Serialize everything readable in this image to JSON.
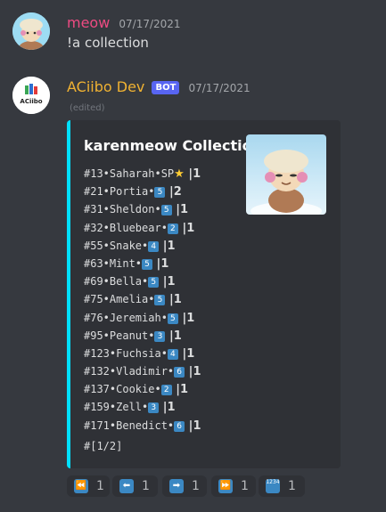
{
  "message1": {
    "username": "meow",
    "username_color": "#ed4b82",
    "timestamp": "07/17/2021",
    "content": "!a collection"
  },
  "message2": {
    "username": "ACiibo Dev",
    "username_color": "#f0b232",
    "bot_tag": "BOT",
    "timestamp": "07/17/2021",
    "edited": "(edited)",
    "avatar_logo_text": "ACiibo",
    "embed": {
      "accent_color": "#00e0ff",
      "title": "karenmeow Collection",
      "entries": [
        {
          "text": "#13•Saharah•SP",
          "badge": "",
          "star": "★",
          "count": "1"
        },
        {
          "text": "#21•Portia•",
          "badge": "5",
          "star": "",
          "count": "2"
        },
        {
          "text": "#31•Sheldon•",
          "badge": "5",
          "star": "",
          "count": "1"
        },
        {
          "text": "#32•Bluebear•",
          "badge": "2",
          "star": "",
          "count": "1"
        },
        {
          "text": "#55•Snake•",
          "badge": "4",
          "star": "",
          "count": "1"
        },
        {
          "text": "#63•Mint•",
          "badge": "5",
          "star": "",
          "count": "1"
        },
        {
          "text": "#69•Bella•",
          "badge": "5",
          "star": "",
          "count": "1"
        },
        {
          "text": "#75•Amelia•",
          "badge": "5",
          "star": "",
          "count": "1"
        },
        {
          "text": "#76•Jeremiah•",
          "badge": "5",
          "star": "",
          "count": "1"
        },
        {
          "text": "#95•Peanut•",
          "badge": "3",
          "star": "",
          "count": "1"
        },
        {
          "text": "#123•Fuchsia•",
          "badge": "4",
          "star": "",
          "count": "1"
        },
        {
          "text": "#132•Vladimir•",
          "badge": "6",
          "star": "",
          "count": "1"
        },
        {
          "text": "#137•Cookie•",
          "badge": "2",
          "star": "",
          "count": "1"
        },
        {
          "text": "#159•Zell•",
          "badge": "3",
          "star": "",
          "count": "1"
        },
        {
          "text": "#171•Benedict•",
          "badge": "6",
          "star": "",
          "count": "1"
        }
      ],
      "page": "#[1/2]"
    }
  },
  "reactions": [
    {
      "icon": "first-page-icon",
      "glyph": "⏪",
      "count": "1"
    },
    {
      "icon": "prev-page-icon",
      "glyph": "⬅",
      "count": "1"
    },
    {
      "icon": "next-page-icon",
      "glyph": "➡",
      "count": "1"
    },
    {
      "icon": "last-page-icon",
      "glyph": "⏩",
      "count": "1"
    },
    {
      "icon": "numbers-icon",
      "glyph": "1234",
      "count": "1"
    }
  ]
}
